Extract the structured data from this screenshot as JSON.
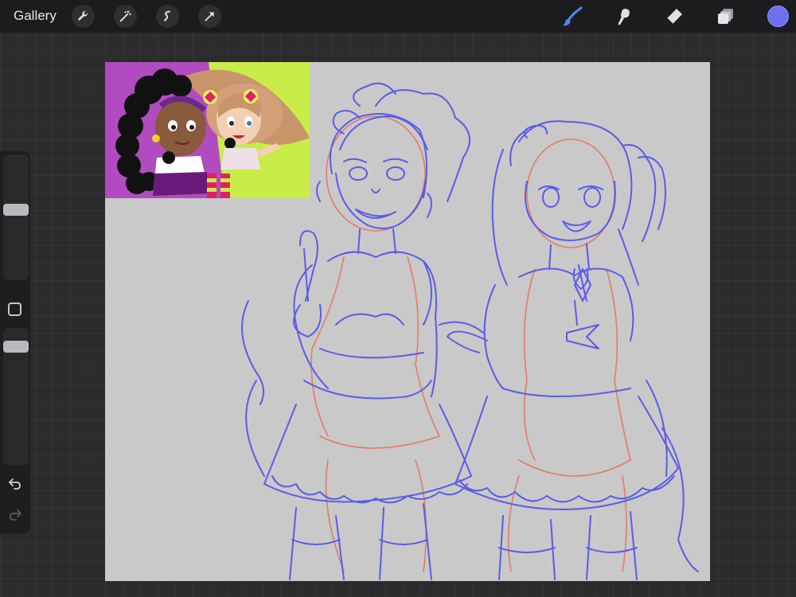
{
  "topbar": {
    "gallery_label": "Gallery",
    "left_tools": [
      "wrench-icon",
      "magic-wand-icon",
      "selection-icon",
      "transform-arrow-icon"
    ],
    "right_tools": [
      "brush-icon",
      "smudge-icon",
      "eraser-icon",
      "layers-icon"
    ],
    "active_tool": "brush-icon",
    "active_color": "#6e70f0"
  },
  "sidebar": {
    "brush_size_level": 0.3,
    "opacity_level": 0.2
  },
  "colors": {
    "sketch_blue": "#5a5ce8",
    "sketch_red": "#e8735a",
    "canvas_bg": "#c9c9c9"
  }
}
